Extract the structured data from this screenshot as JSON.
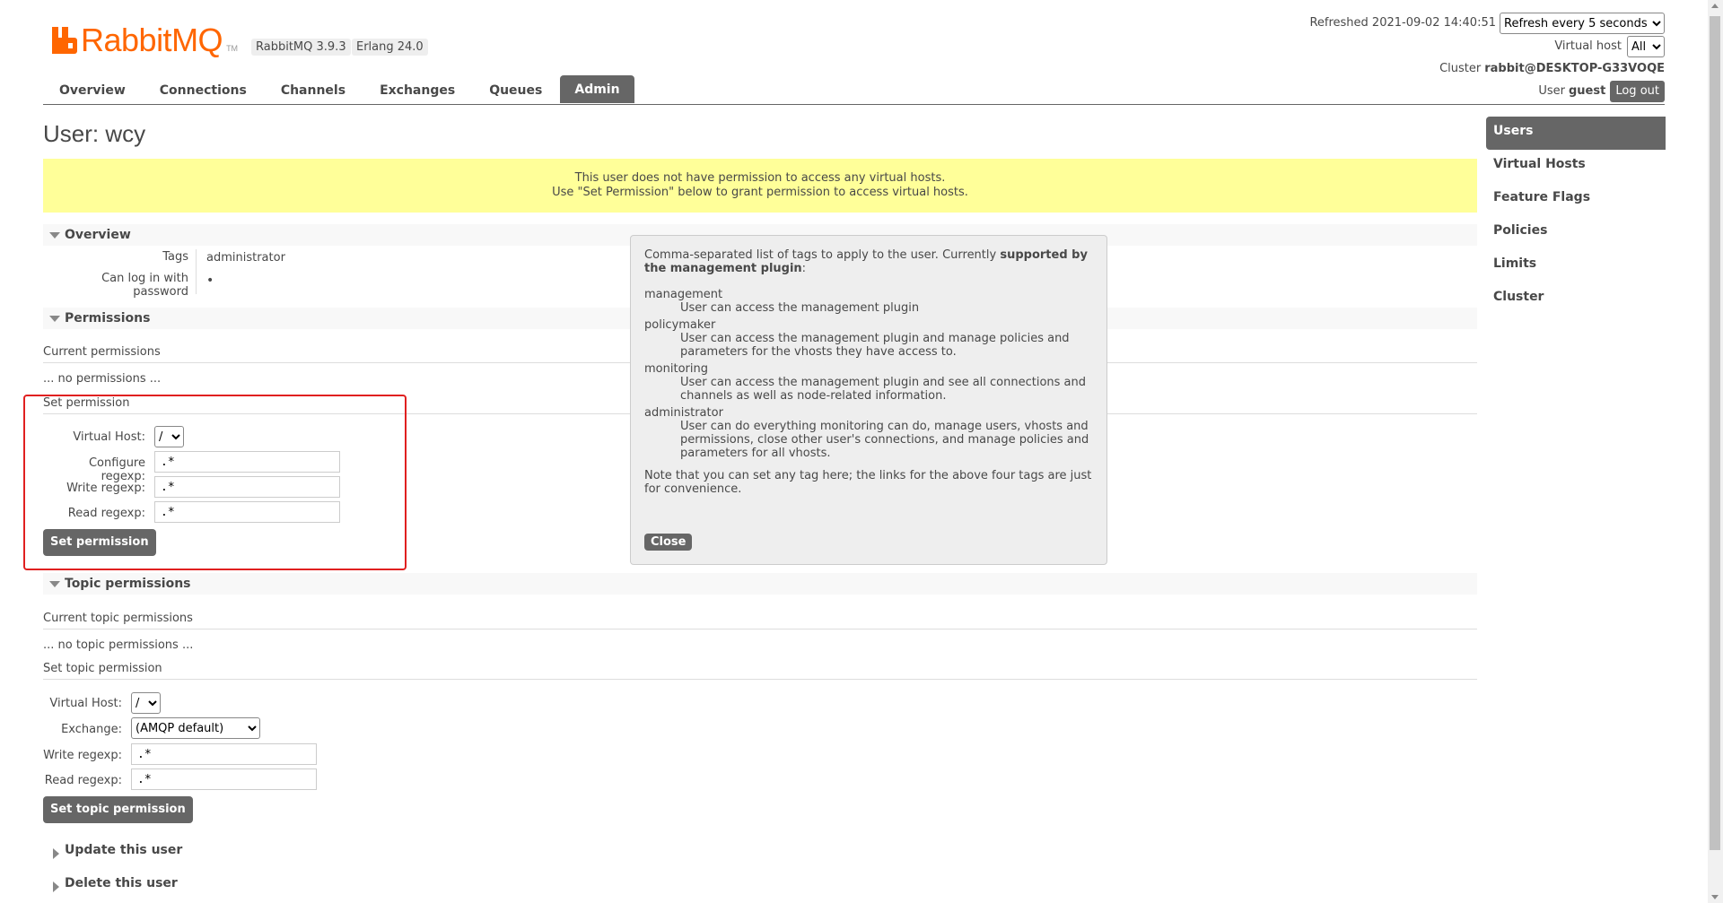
{
  "header": {
    "logo_text": "RabbitMQ",
    "logo_tm": "TM",
    "version_badge": "RabbitMQ 3.9.3",
    "erlang_badge": "Erlang 24.0",
    "refreshed_label": "Refreshed 2021-09-02 14:40:51",
    "refresh_select": "Refresh every 5 seconds",
    "vhost_label": "Virtual host",
    "vhost_select": "All",
    "cluster_label": "Cluster",
    "cluster_value": "rabbit@DESKTOP-G33VOQE",
    "user_label": "User",
    "user_value": "guest",
    "logout_label": "Log out",
    "accent_color": "#ff6600"
  },
  "tabs": [
    {
      "label": "Overview"
    },
    {
      "label": "Connections"
    },
    {
      "label": "Channels"
    },
    {
      "label": "Exchanges"
    },
    {
      "label": "Queues"
    },
    {
      "label": "Admin",
      "active": true
    }
  ],
  "sidebar": {
    "items": [
      {
        "label": "Users",
        "active": true
      },
      {
        "label": "Virtual Hosts"
      },
      {
        "label": "Feature Flags"
      },
      {
        "label": "Policies"
      },
      {
        "label": "Limits"
      },
      {
        "label": "Cluster"
      }
    ]
  },
  "page": {
    "title_prefix": "User:",
    "title_user": "wcy",
    "warning_line1": "This user does not have permission to access any virtual hosts.",
    "warning_line2": "Use \"Set Permission\" below to grant permission to access virtual hosts.",
    "warning_color": "#ffff99"
  },
  "overview": {
    "heading": "Overview",
    "tags_label": "Tags",
    "tags_value": "administrator",
    "login_label": "Can log in with password",
    "login_value": "•"
  },
  "permissions": {
    "heading": "Permissions",
    "current_heading": "Current permissions",
    "none_text": "... no permissions ...",
    "set_heading": "Set permission",
    "vhost_label": "Virtual Host:",
    "vhost_value": "/",
    "configure_label": "Configure regexp:",
    "configure_value": ".*",
    "write_label": "Write regexp:",
    "write_value": ".*",
    "read_label": "Read regexp:",
    "read_value": ".*",
    "button": "Set permission"
  },
  "topic_permissions": {
    "heading": "Topic permissions",
    "current_heading": "Current topic permissions",
    "none_text": "... no topic permissions ...",
    "set_heading": "Set topic permission",
    "vhost_label": "Virtual Host:",
    "vhost_value": "/",
    "exchange_label": "Exchange:",
    "exchange_value": "(AMQP default)",
    "write_label": "Write regexp:",
    "write_value": ".*",
    "read_label": "Read regexp:",
    "read_value": ".*",
    "button": "Set topic permission"
  },
  "collapsed_sections": {
    "update": "Update this user",
    "delete": "Delete this user"
  },
  "popup": {
    "intro_text": "Comma-separated list of tags to apply to the user. Currently ",
    "intro_bold": "supported by the management plugin",
    "intro_end": ":",
    "tags": [
      {
        "name": "management",
        "desc": "User can access the management plugin"
      },
      {
        "name": "policymaker",
        "desc": "User can access the management plugin and manage policies and parameters for the vhosts they have access to."
      },
      {
        "name": "monitoring",
        "desc": "User can access the management plugin and see all connections and channels as well as node-related information."
      },
      {
        "name": "administrator",
        "desc": "User can do everything monitoring can do, manage users, vhosts and permissions, close other user's connections, and manage policies and parameters for all vhosts."
      }
    ],
    "note": "Note that you can set any tag here; the links for the above four tags are just for convenience.",
    "close_label": "Close"
  },
  "annotation": {
    "highlight_color": "#e02020"
  }
}
